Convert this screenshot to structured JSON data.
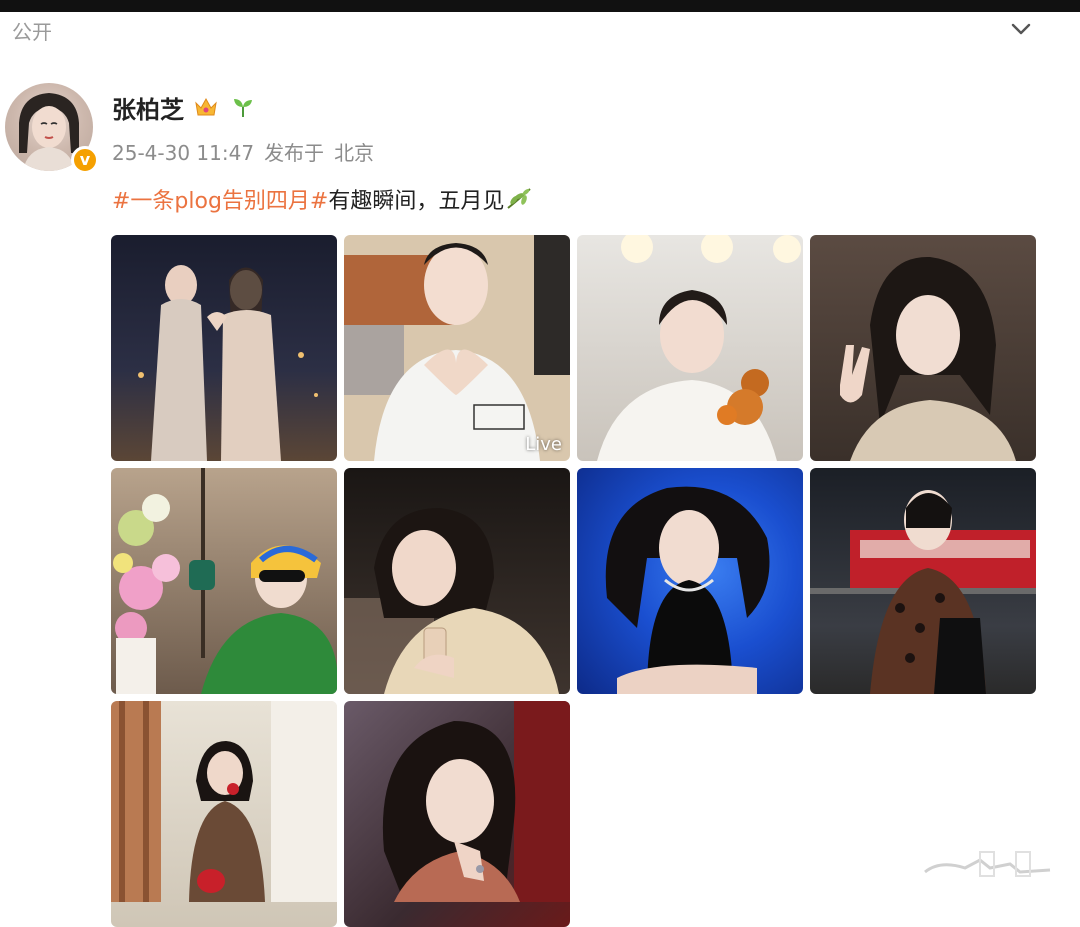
{
  "header": {
    "visibility_label": "公开",
    "collapse_icon": "chevron-down-icon"
  },
  "post": {
    "author": {
      "name": "张柏芝",
      "badges": [
        "crown-icon",
        "sprout-icon"
      ],
      "verified_icon": "verified-v-badge"
    },
    "time": "25-4-30 11:47",
    "source_prefix": "发布于",
    "location": "北京",
    "text": {
      "hashtag": "#一条plog告别四月#",
      "body": "有趣瞬间，五月见",
      "emoji_icon": "olive-branch-icon"
    },
    "photos": [
      {
        "id": "photo-1",
        "desc": "two women in sequin gowns making heart gesture",
        "live": false
      },
      {
        "id": "photo-2",
        "desc": "woman in white tee making heart hands",
        "live": true,
        "live_label": "Live"
      },
      {
        "id": "photo-3",
        "desc": "woman holding plush bear keychain",
        "live": false
      },
      {
        "id": "photo-4",
        "desc": "woman making peace sign",
        "live": false
      },
      {
        "id": "photo-5",
        "desc": "woman in colorful hat with flowers",
        "live": false
      },
      {
        "id": "photo-6",
        "desc": "woman holding phone in beige blazer",
        "live": false
      },
      {
        "id": "photo-7",
        "desc": "woman in black top against blue background",
        "live": false
      },
      {
        "id": "photo-8",
        "desc": "woman in leopard print on street",
        "live": false
      },
      {
        "id": "photo-9",
        "desc": "woman in brown coat with red telephone",
        "live": false
      },
      {
        "id": "photo-10",
        "desc": "woman with wavy hair, hand on chin",
        "live": false
      }
    ]
  },
  "colors": {
    "hashtag": "#eb7340",
    "meta_text": "#8c8c8c",
    "verified_badge": "#f5a000"
  }
}
